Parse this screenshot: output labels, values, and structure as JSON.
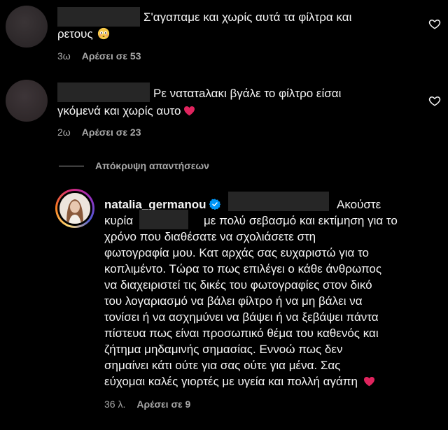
{
  "comments": [
    {
      "line1": "Σ'αγαπαμε και χωρίς αυτά τα φίλτρα και",
      "line2": "ρετους",
      "time": "3ω",
      "likes": "Αρέσει σε 53",
      "emoji": "flushed-face-emoji"
    },
    {
      "line1": "Ρε νατατaλακι βγάλε το φίλτρο είσαι",
      "line2": "γκόμενά και χωρίς αυτο",
      "time": "2ω",
      "likes": "Αρέσει σε 23",
      "emoji": "red-heart-emoji"
    }
  ],
  "hide_replies_label": "Απόκρυψη απαντήσεων",
  "reply": {
    "username": "natalia_germanou",
    "verified_icon": "verified-badge-icon",
    "lines": [
      "Ακούστε",
      "κυρία",
      "με πολύ σεβασμό και εκτίμηση για το",
      "χρόνο που διαθέσατε να σχολιάσετε στη",
      "φωτογραφία μου. Κατ αρχάς σας ευχαριστώ για το",
      "κοπλιμέντο. Τώρα το πως επιλέγει ο κάθε άνθρωπος",
      "να διαχειριστεί τις δικές του φωτογραφίες στον δικό",
      "του λογαριασμό να βάλει φίλτρο ή να μη βάλει να",
      "τονίσει ή να ασχημύνει να βάψει ή να ξεβάψει πάντα",
      "πίστευα πως είναι προσωπικό θέμα του καθενός και",
      "ζήτημα μηδαμινής σημασίας. Εννοώ πως δεν",
      "σημαίνει κάτι ούτε για σας ούτε για μένα. Σας",
      "εύχομαι καλές γιορτές με υγεία και πολλή αγάπη"
    ],
    "time": "36 λ.",
    "likes": "Αρέσει σε 9",
    "emoji": "red-heart-emoji"
  },
  "colors": {
    "background": "#000000",
    "text": "#f5f5f5",
    "secondary": "#a8a8a8",
    "redaction": "#262626",
    "heart_emoji": "#e0245e",
    "verified": "#0095f6"
  },
  "icons": [
    "heart-outline-icon",
    "verified-badge-icon"
  ]
}
